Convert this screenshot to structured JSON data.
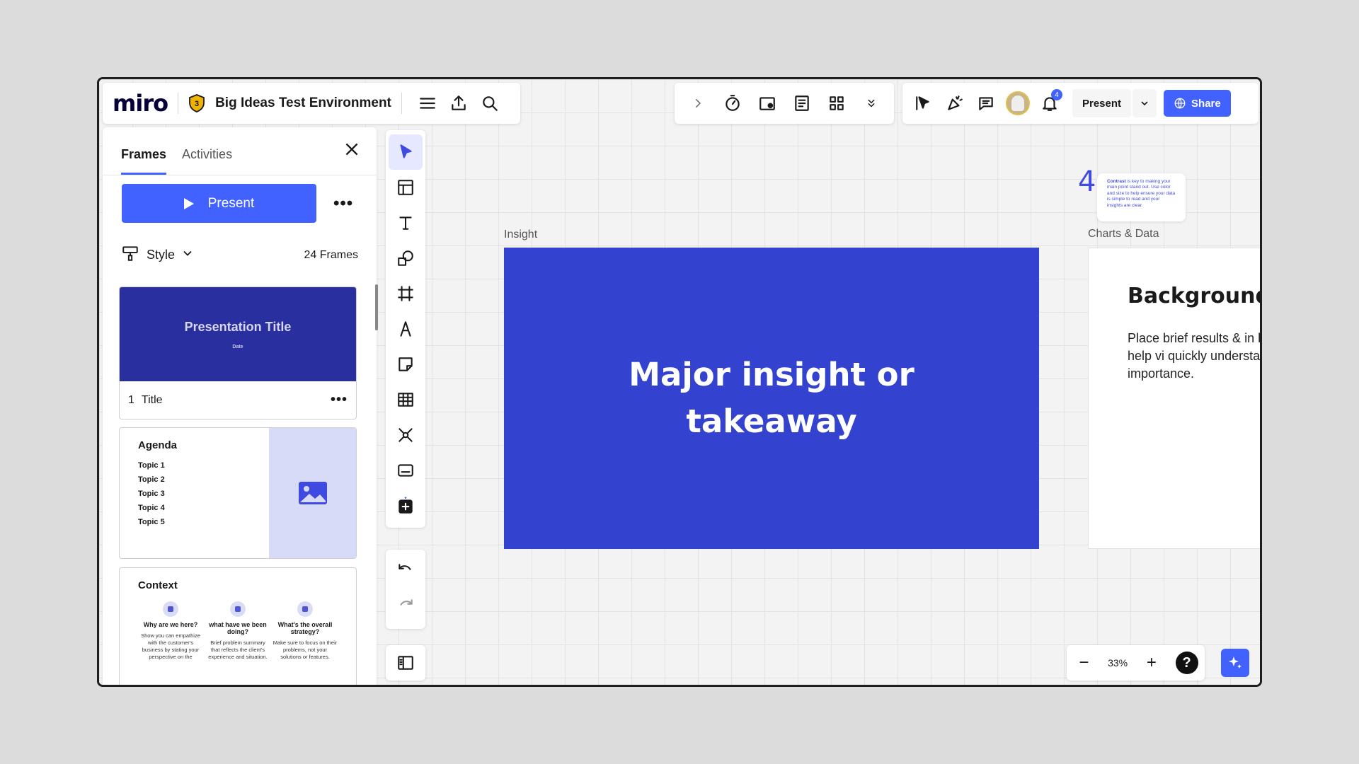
{
  "header": {
    "logo": "miro",
    "plan_badge": "3",
    "board_title": "Big Ideas Test Environment",
    "notification_count": "4",
    "present_label": "Present",
    "share_label": "Share"
  },
  "panel": {
    "tabs": [
      {
        "label": "Frames"
      },
      {
        "label": "Activities"
      }
    ],
    "present_button": "Present",
    "style_label": "Style",
    "frames_count": "24 Frames",
    "thumbnails": {
      "title_frame": {
        "title": "Presentation Title",
        "date": "Date",
        "number": "1",
        "name": "Title"
      },
      "agenda": {
        "heading": "Agenda",
        "topics": [
          "Topic 1",
          "Topic 2",
          "Topic 3",
          "Topic 4",
          "Topic 5"
        ]
      },
      "context": {
        "heading": "Context",
        "columns": [
          {
            "q": "Why are we here?",
            "a": "Show you can empathize with the customer's business by stating your perspective on the"
          },
          {
            "q": "what have we been doing?",
            "a": "Brief problem summary that reflects the client's experience and situation."
          },
          {
            "q": "What's the overall strategy?",
            "a": "Make sure to focus on their problems, not your solutions or features."
          }
        ]
      }
    }
  },
  "canvas": {
    "insight_label": "Insight",
    "insight_text": "Major insight or takeaway",
    "charts_label": "Charts & Data",
    "background_title": "Background",
    "background_body": "Place brief results & in here. It should help vi quickly understand th importance.",
    "sticky_number": "4",
    "sticky_text_bold": "Contrast",
    "sticky_text": " is key to making your main point stand out. Use color and size to help ensure your data is simple to read and your insights are clear."
  },
  "zoom": {
    "level": "33%",
    "help": "?"
  },
  "colors": {
    "accent": "#4262ff",
    "insight_frame": "#3343cf",
    "title_thumb": "#2a2fa0"
  }
}
